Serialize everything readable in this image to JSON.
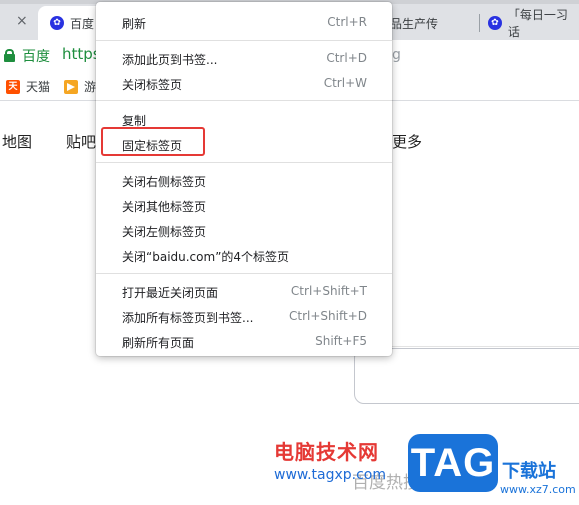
{
  "tabs": [
    {
      "title": "百度",
      "active": true
    },
    {
      "title": "品生产传",
      "active": false
    },
    {
      "title": "「每日一习话",
      "active": false
    }
  ],
  "tab_close_glyph": "×",
  "address": {
    "site_name": "百度",
    "url_visible": "https",
    "url_tail": "g"
  },
  "bookmarks": [
    {
      "label": "天猫",
      "icon": "tmall-icon"
    },
    {
      "label": "游",
      "icon": "game-icon"
    }
  ],
  "page": {
    "nav_links": [
      "地图",
      "贴吧",
      "更多"
    ],
    "ghost_search_text": "百度热搜"
  },
  "context_menu": {
    "items": [
      {
        "label": "刷新",
        "shortcut": "Ctrl+R"
      },
      {
        "label": "添加此页到书签...",
        "shortcut": "Ctrl+D"
      },
      {
        "label": "关闭标签页",
        "shortcut": "Ctrl+W"
      },
      {
        "label": "复制",
        "shortcut": ""
      },
      {
        "label": "固定标签页",
        "shortcut": "",
        "highlighted": true
      },
      {
        "label": "关闭右侧标签页",
        "shortcut": ""
      },
      {
        "label": "关闭其他标签页",
        "shortcut": ""
      },
      {
        "label": "关闭左侧标签页",
        "shortcut": ""
      },
      {
        "label": "关闭“baidu.com”的4个标签页",
        "shortcut": ""
      },
      {
        "label": "打开最近关闭页面",
        "shortcut": "Ctrl+Shift+T"
      },
      {
        "label": "添加所有标签页到书签...",
        "shortcut": "Ctrl+Shift+D"
      },
      {
        "label": "刷新所有页面",
        "shortcut": "Shift+F5"
      }
    ]
  },
  "watermark": {
    "site_cn": "电脑技术网",
    "site_url": "www.tagxp.com",
    "badge": "TAG",
    "download_cn": "下载站",
    "download_url": "www.xz7.com"
  },
  "colors": {
    "highlight_border": "#e53935",
    "secure_green": "#1e8e3e",
    "tag_blue": "#1a73d9"
  }
}
